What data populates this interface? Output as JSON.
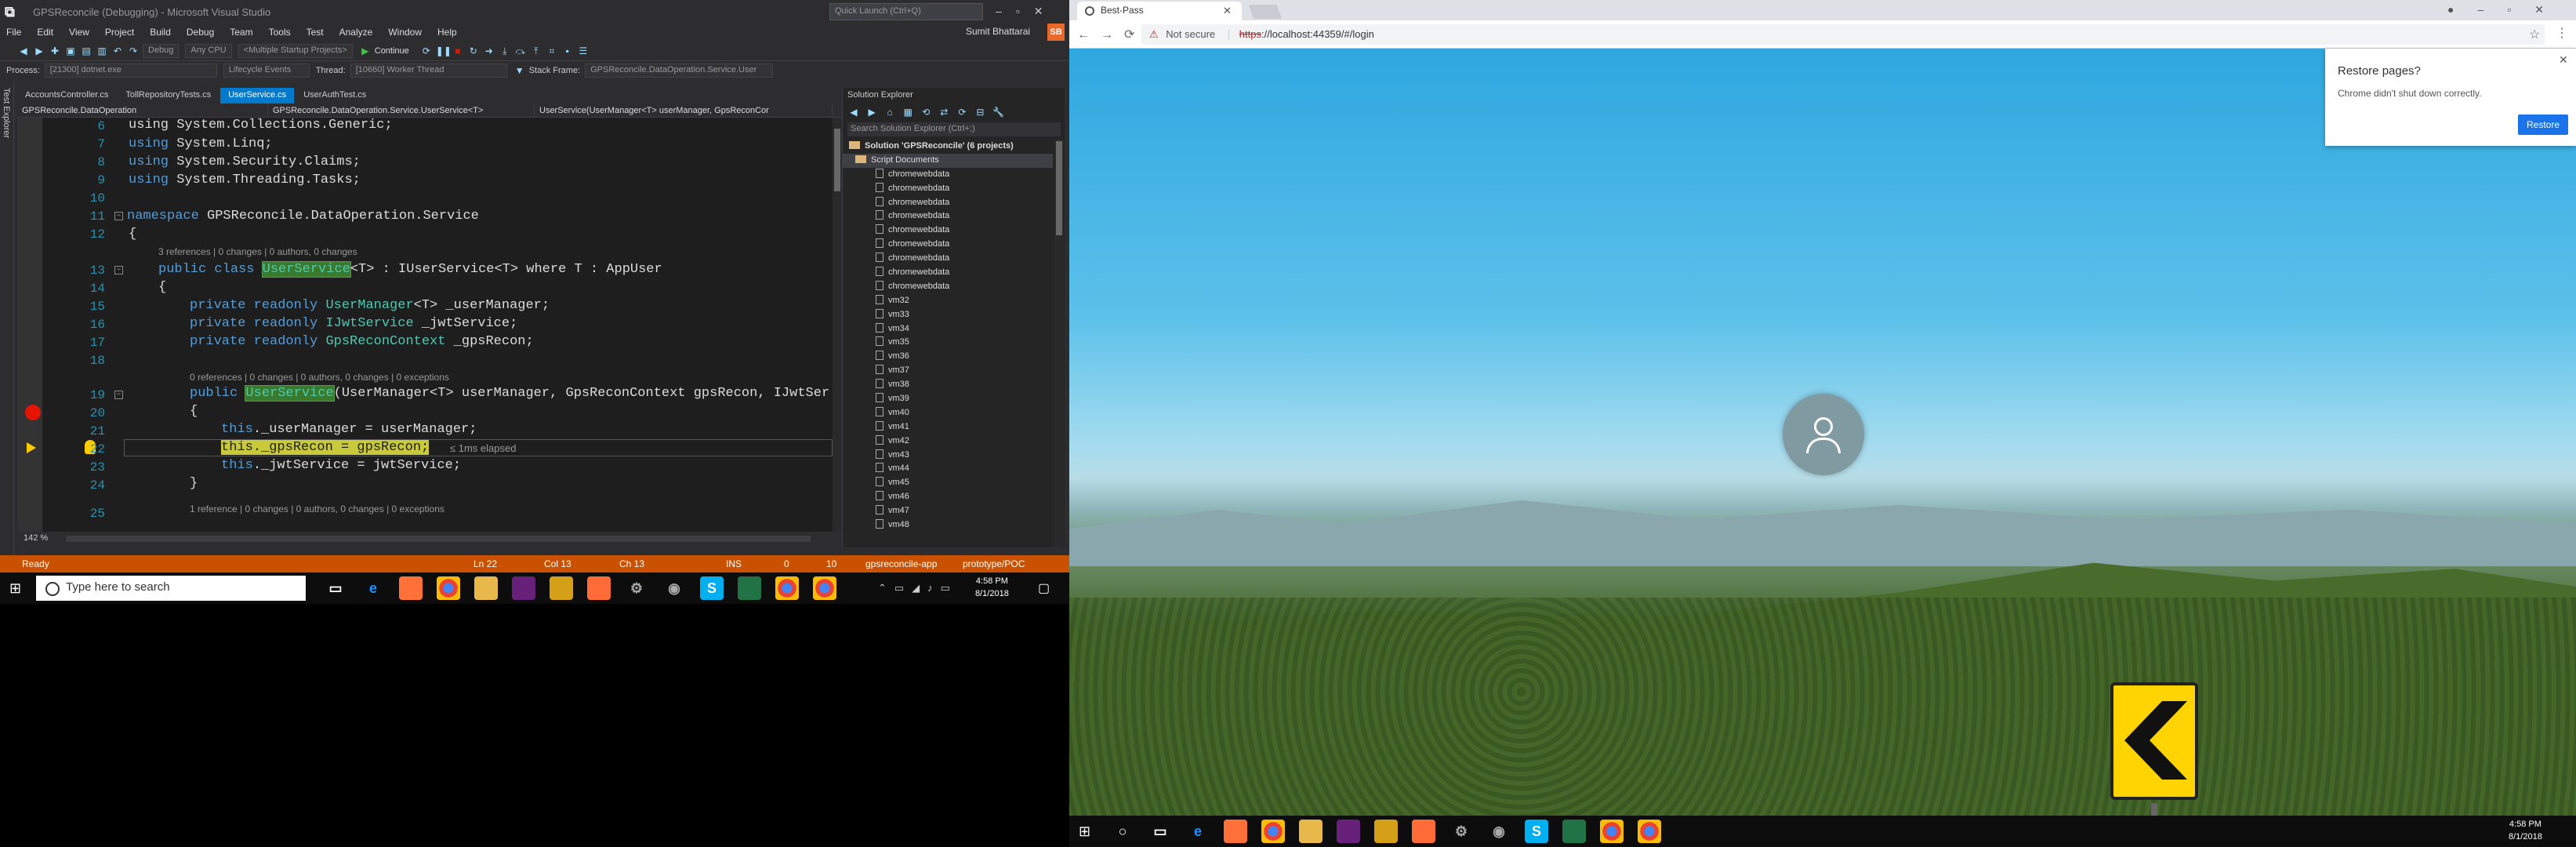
{
  "vs": {
    "title": "GPSReconcile (Debugging) - Microsoft Visual Studio",
    "quick_launch": "Quick Launch (Ctrl+Q)",
    "menu": [
      "File",
      "Edit",
      "View",
      "Project",
      "Build",
      "Debug",
      "Team",
      "Tools",
      "Test",
      "Analyze",
      "Window",
      "Help"
    ],
    "user": "Sumit Bhattarai",
    "user_initials": "SB",
    "toolbar": {
      "config": "Debug",
      "platform": "Any CPU",
      "startup": "<Multiple Startup Projects>",
      "continue_label": "Continue"
    },
    "debug_bar": {
      "process_label": "Process:",
      "process": "[21300] dotnet.exe",
      "lifecycle": "Lifecycle Events",
      "thread_label": "Thread:",
      "thread": "[10660] Worker Thread",
      "stack_label": "Stack Frame:",
      "stack": "GPSReconcile.DataOperation.Service.User"
    },
    "left_strip": "Test Explorer",
    "tabs": [
      {
        "label": "AccountsController.cs"
      },
      {
        "label": "TollRepositoryTests.cs"
      },
      {
        "label": "UserService.cs"
      },
      {
        "label": "UserAuthTest.cs"
      }
    ],
    "nav": {
      "project": "GPSReconcile.DataOperation",
      "type": "GPSReconcile.DataOperation.Service.UserService<T>",
      "member": "UserService(UserManager<T> userManager, GpsReconCor"
    },
    "code": {
      "l6": "using System.Collections.Generic;",
      "l7_using": "using",
      "l7": " System.Linq;",
      "l8_using": "using",
      "l8": " System.Security.Claims;",
      "l9_using": "using",
      "l9": " System.Threading.Tasks;",
      "l11_kw": "namespace",
      "l11": " GPSReconcile.DataOperation.Service",
      "l12": "{",
      "lens13": "3 references | 0 changes | 0 authors, 0 changes",
      "l13_kw": "public class ",
      "l13_name": "UserService",
      "l13_rest": "<T> : IUserService<T> where T : AppUser",
      "l14": "{",
      "l15_kw": "private readonly ",
      "l15_ty": "UserManager",
      "l15_rest": "<T> _userManager;",
      "l16_kw": "private readonly ",
      "l16_ty": "IJwtService",
      "l16_rest": " _jwtService;",
      "l17_kw": "private readonly ",
      "l17_ty": "GpsReconContext",
      "l17_rest": " _gpsRecon;",
      "lens19": "0 references | 0 changes | 0 authors, 0 changes | 0 exceptions",
      "l19_kw": "public ",
      "l19_name": "UserService",
      "l19_rest": "(UserManager<T> userManager, GpsReconContext gpsRecon, IJwtSer",
      "l20": "{",
      "l21_this": "this",
      "l21": "._userManager = userManager;",
      "l22": "this._gpsRecon = gpsRecon;",
      "elapsed": "≤ 1ms elapsed",
      "l23_this": "this",
      "l23": "._jwtService = jwtService;",
      "l24": "}",
      "lens25": "1 reference | 0 changes | 0 authors, 0 changes | 0 exceptions"
    },
    "line_numbers": [
      "6",
      "7",
      "8",
      "9",
      "10",
      "11",
      "12",
      "13",
      "14",
      "15",
      "16",
      "17",
      "18",
      "19",
      "20",
      "21",
      "22",
      "23",
      "24",
      "25"
    ],
    "zoom": "142 %",
    "solution_explorer": {
      "title": "Solution Explorer",
      "search": "Search Solution Explorer (Ctrl+;)",
      "solution": "Solution 'GPSReconcile' (6 projects)",
      "folder": "Script Documents",
      "items": [
        "chromewebdata",
        "chromewebdata",
        "chromewebdata",
        "chromewebdata",
        "chromewebdata",
        "chromewebdata",
        "chromewebdata",
        "chromewebdata",
        "chromewebdata",
        "vm32",
        "vm33",
        "vm34",
        "vm35",
        "vm36",
        "vm37",
        "vm38",
        "vm39",
        "vm40",
        "vm41",
        "vm42",
        "vm43",
        "vm44",
        "vm45",
        "vm46",
        "vm47",
        "vm48"
      ]
    },
    "status": {
      "ready": "Ready",
      "ln": "Ln 22",
      "col": "Col 13",
      "ch": "Ch 13",
      "ins": "INS",
      "up": "0",
      "edits": "10",
      "repo": "gpsreconcile-app",
      "branch": "prototype/POC"
    }
  },
  "taskbar_left": {
    "search": "Type here to search",
    "time": "4:58 PM",
    "date": "8/1/2018"
  },
  "taskbar_right": {
    "time": "4:58 PM",
    "date": "8/1/2018"
  },
  "chrome": {
    "tab_title": "Best-Pass",
    "not_secure": "Not secure",
    "url_protocol": "https",
    "url_rest": "://localhost:44359/#/login",
    "restore": {
      "title": "Restore pages?",
      "message": "Chrome didn't shut down correctly.",
      "button": "Restore"
    }
  },
  "colors": {
    "vs_accent": "#007acc",
    "vs_status": "#ca5100",
    "chrome_restore": "#1a73e8"
  }
}
